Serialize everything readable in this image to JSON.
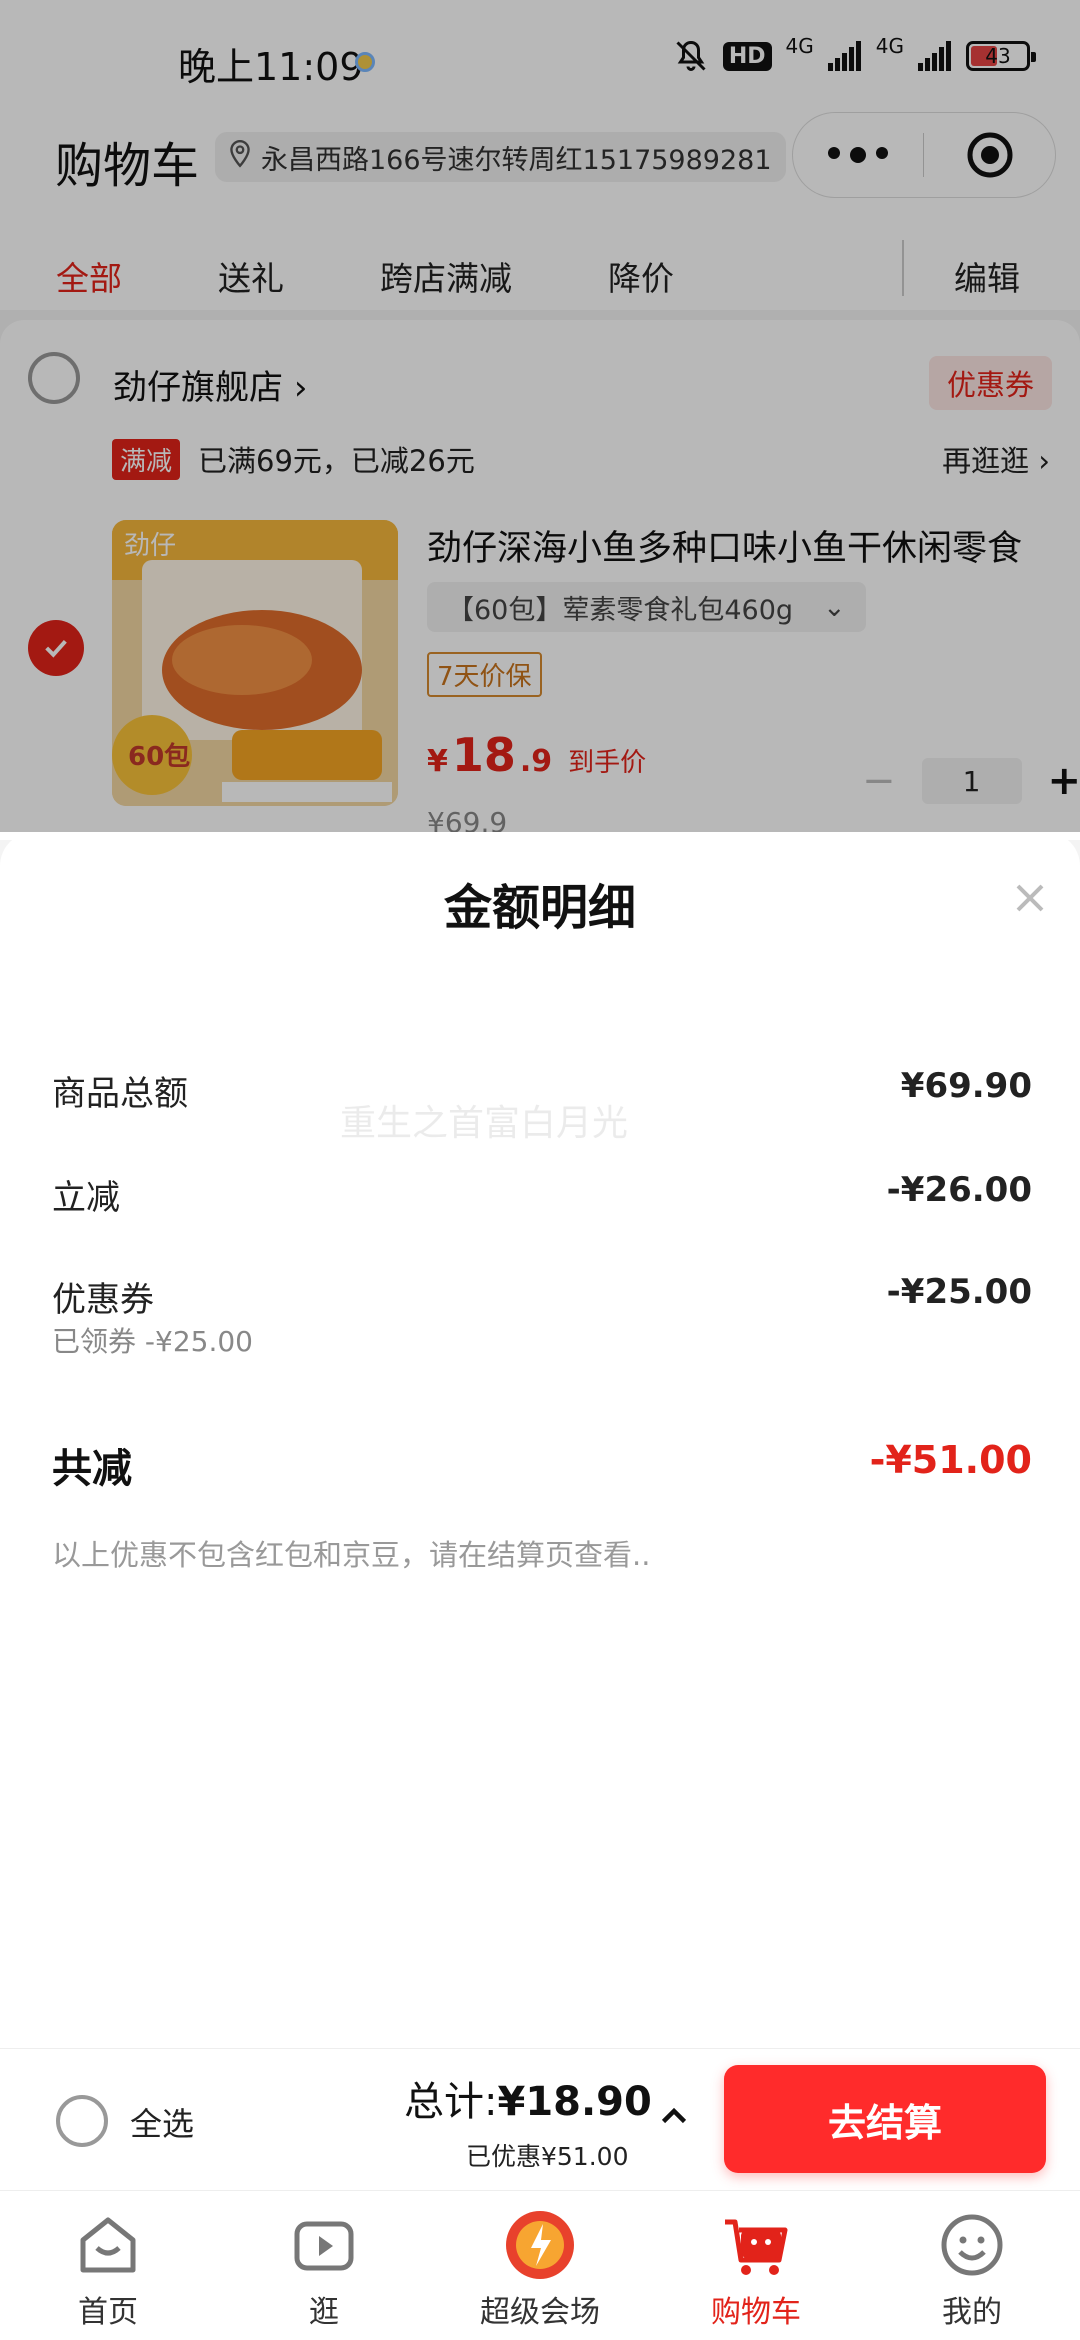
{
  "status_bar": {
    "time": "晚上11:09",
    "hd": "HD",
    "net1": "4G",
    "net2": "4G",
    "battery": "43"
  },
  "header": {
    "title": "购物车",
    "address": "永昌西路166号速尔转周红15175989281"
  },
  "tabs": [
    {
      "label": "全部",
      "active": true
    },
    {
      "label": "送礼"
    },
    {
      "label": "跨店满减"
    },
    {
      "label": "降价"
    },
    {
      "label": "编辑"
    }
  ],
  "store": {
    "name": "劲仔旗舰店",
    "coupon_label": "优惠券",
    "promo_tag": "满减",
    "promo_text": "已满69元，已减26元",
    "browse_more": "再逛逛"
  },
  "product": {
    "title": "劲仔深海小鱼多种口味小鱼干休闲零食",
    "spec": "【60包】荤素零食礼包460g",
    "guarantee": "7天价保",
    "currency": "¥",
    "price_int": "18",
    "price_dec": ".9",
    "price_label": "到手价",
    "original_price": "¥69.9",
    "quantity": "1",
    "image_brand": "劲仔",
    "image_count": "60包"
  },
  "sheet": {
    "title": "金额明细",
    "rows": [
      {
        "label": "商品总额",
        "value": "¥69.90"
      },
      {
        "label": "立减",
        "value": "-¥26.00"
      },
      {
        "label": "优惠券",
        "value": "-¥25.00"
      }
    ],
    "coupon_sub": "已领券 -¥25.00",
    "total_label": "共减",
    "total_value": "-¥51.00",
    "disclaimer": "以上优惠不包含红包和京豆，请在结算页查看..",
    "watermark": "重生之首富白月光"
  },
  "checkout": {
    "select_all": "全选",
    "total_prefix": "总计:",
    "total_amount": "¥18.90",
    "saved": "已优惠¥51.00",
    "button": "去结算"
  },
  "nav": [
    {
      "label": "首页",
      "icon": "home-icon"
    },
    {
      "label": "逛",
      "icon": "video-icon"
    },
    {
      "label": "超级会场",
      "icon": "super-venue-icon"
    },
    {
      "label": "购物车",
      "icon": "cart-icon",
      "active": true
    },
    {
      "label": "我的",
      "icon": "profile-icon"
    }
  ],
  "colors": {
    "accent": "#e2231a",
    "checkout_button": "#ff2b2b"
  }
}
